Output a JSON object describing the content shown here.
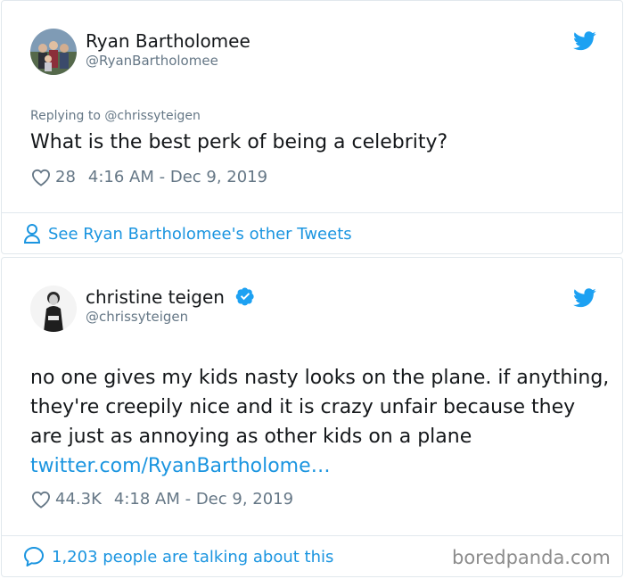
{
  "tweet1": {
    "author_name": "Ryan Bartholomee",
    "author_handle": "@RyanBartholomee",
    "replying_to": "Replying to @chrissyteigen",
    "text": "What is the best perk of being a celebrity?",
    "likes": "28",
    "timestamp": "4:16 AM - Dec 9, 2019",
    "see_more": "See Ryan Bartholomee's other Tweets",
    "icons": {
      "like": "heart-icon",
      "brand": "twitter-bird-icon",
      "see_more": "person-icon"
    }
  },
  "tweet2": {
    "author_name": "christine teigen",
    "author_handle": "@chrissyteigen",
    "text": "no one gives my kids nasty looks on the plane. if anything, they're creepily nice and it is crazy unfair because they are just as annoying as other kids on a plane ",
    "link_text": "twitter.com/RyanBartholome…",
    "likes": "44.3K",
    "timestamp": "4:18 AM - Dec 9, 2019",
    "talking_about": "1,203 people are talking about this",
    "icons": {
      "like": "heart-icon",
      "brand": "twitter-bird-icon",
      "verified": "verified-badge-icon",
      "talking": "speech-bubble-icon"
    }
  },
  "watermark": "boredpanda.com",
  "colors": {
    "link": "#1b95e0",
    "muted": "#657786",
    "text": "#14171a",
    "border": "#e1e8ed"
  }
}
